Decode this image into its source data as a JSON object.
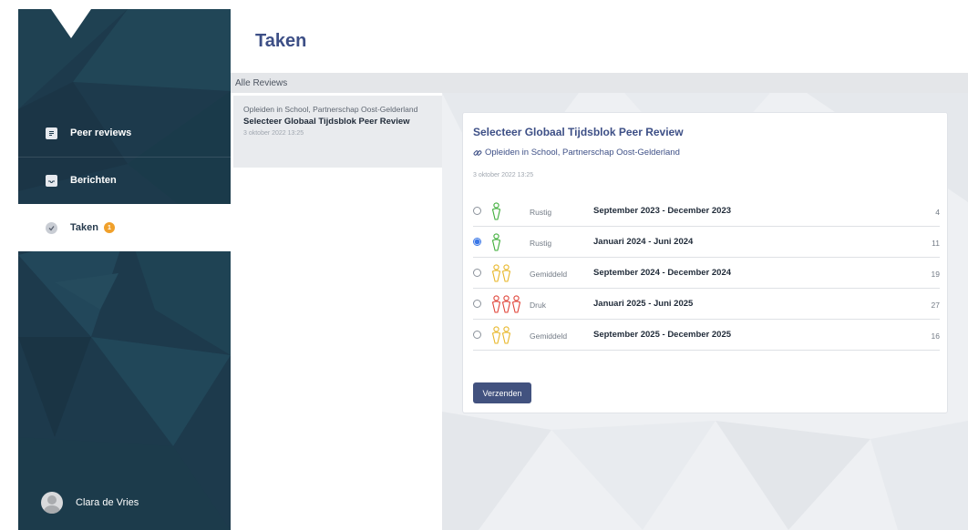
{
  "sidebar": {
    "items": [
      {
        "label": "Peer reviews",
        "icon": "document-icon"
      },
      {
        "label": "Berichten",
        "icon": "inbox-icon"
      },
      {
        "label": "Taken",
        "icon": "check-circle-icon",
        "badge": "1"
      }
    ],
    "user": {
      "name": "Clara de Vries"
    }
  },
  "header": {
    "title": "Taken"
  },
  "subbar": {
    "label": "Alle Reviews"
  },
  "list": {
    "items": [
      {
        "org": "Opleiden in School, Partnerschap Oost-Gelderland",
        "title": "Selecteer Globaal Tijdsblok Peer Review",
        "date": "3 oktober 2022 13:25"
      }
    ]
  },
  "card": {
    "title": "Selecteer Globaal Tijdsblok Peer Review",
    "org": "Opleiden in School, Partnerschap Oost-Gelderland",
    "date": "3 oktober 2022 13:25",
    "options": [
      {
        "busy": "Rustig",
        "period": "September 2023 - December 2023",
        "count": "4",
        "selected": false,
        "level": 1,
        "color": "#3fae3a"
      },
      {
        "busy": "Rustig",
        "period": "Januari 2024 - Juni 2024",
        "count": "11",
        "selected": true,
        "level": 1,
        "color": "#3fae3a"
      },
      {
        "busy": "Gemiddeld",
        "period": "September 2024 - December 2024",
        "count": "19",
        "selected": false,
        "level": 2,
        "color": "#e8b72a"
      },
      {
        "busy": "Druk",
        "period": "Januari 2025 - Juni 2025",
        "count": "27",
        "selected": false,
        "level": 3,
        "color": "#e0453a"
      },
      {
        "busy": "Gemiddeld",
        "period": "September 2025 - December 2025",
        "count": "16",
        "selected": false,
        "level": 2,
        "color": "#e8b72a"
      }
    ],
    "submit_label": "Verzenden"
  },
  "colors": {
    "sidebar_bg": "#1d3a4c",
    "accent": "#3d4f86",
    "button": "#42527f",
    "badge": "#f0a02b"
  }
}
